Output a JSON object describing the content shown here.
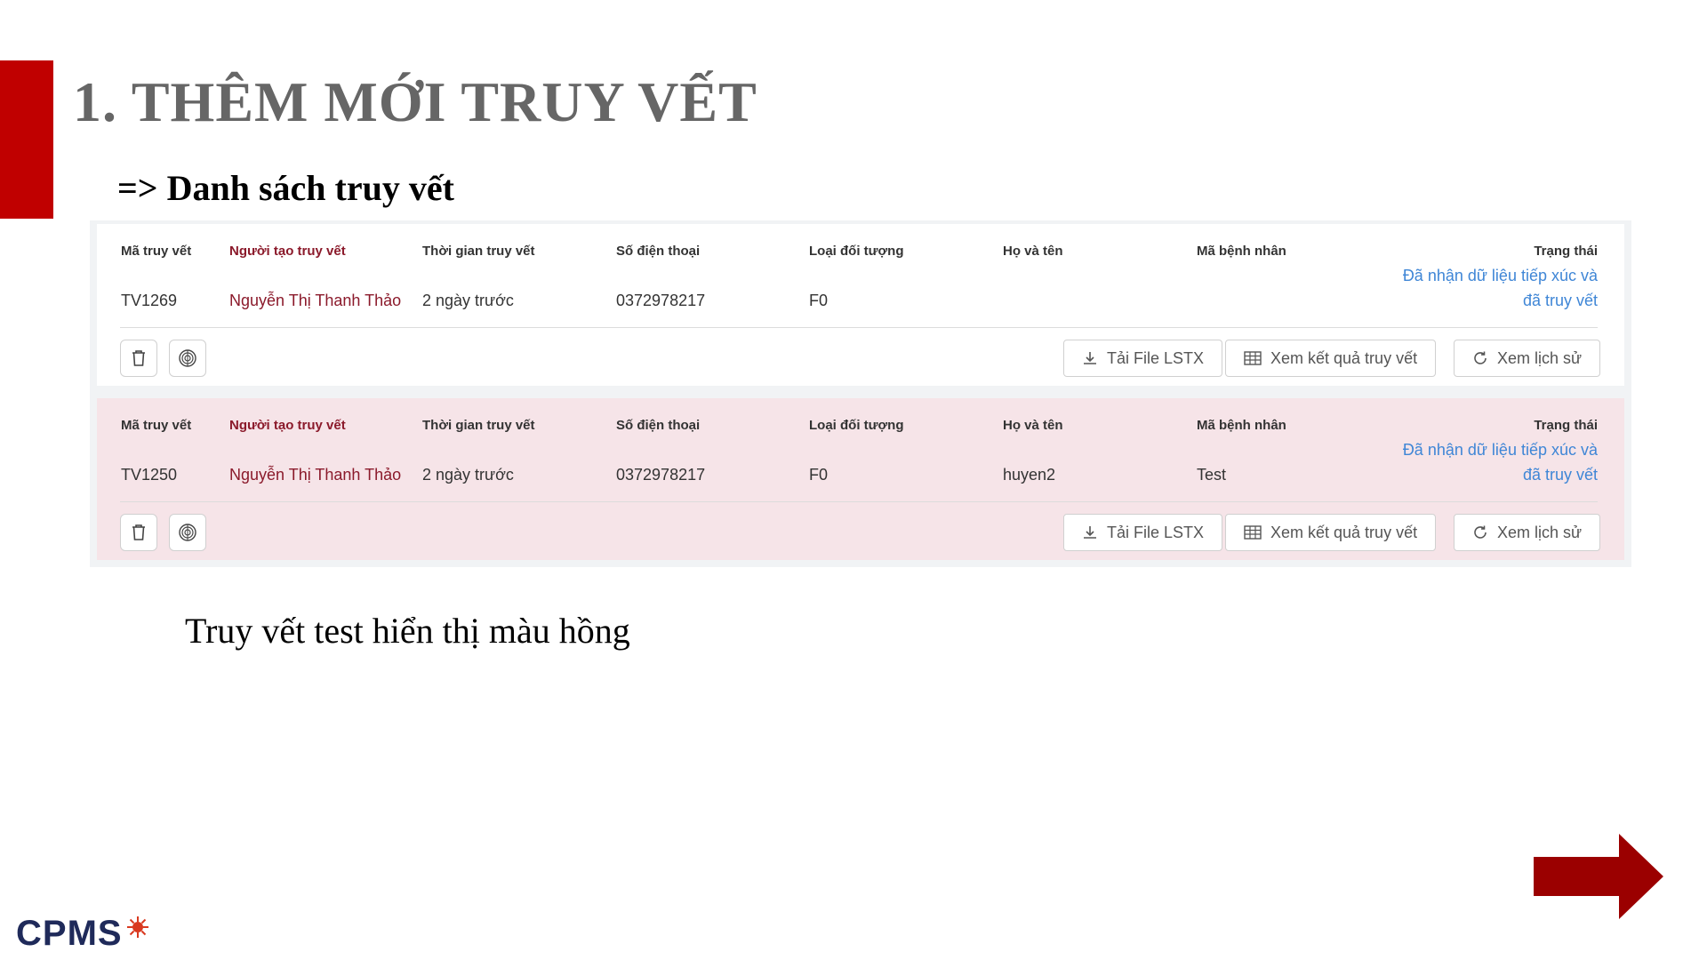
{
  "slide": {
    "title": "1. THÊM MỚI TRUY VẾT",
    "subtitle": "=> Danh sách truy vết",
    "caption": "Truy vết test hiển thị màu hồng",
    "logo": "CPMS",
    "accent_color": "#c00000",
    "arrow_color": "#9b0000"
  },
  "columns": {
    "code": "Mã truy vết",
    "creator": "Người tạo truy vết",
    "time": "Thời gian truy vết",
    "phone": "Số điện thoại",
    "type": "Loại đối tượng",
    "name": "Họ và tên",
    "patient": "Mã bệnh nhân",
    "status": "Trạng thái"
  },
  "records": [
    {
      "code": "TV1269",
      "creator": "Nguyễn Thị Thanh Thảo",
      "time": "2 ngày trước",
      "phone": "0372978217",
      "type": "F0",
      "name": "",
      "patient": "",
      "status_line1": "Đã nhận dữ liệu tiếp xúc và",
      "status_line2": "đã truy vết",
      "highlight": "white"
    },
    {
      "code": "TV1250",
      "creator": "Nguyễn Thị Thanh Thảo",
      "time": "2 ngày trước",
      "phone": "0372978217",
      "type": "F0",
      "name": "huyen2",
      "patient": "Test",
      "status_line1": "Đã nhận dữ liệu tiếp xúc và",
      "status_line2": "đã truy vết",
      "highlight": "pink"
    }
  ],
  "actions": {
    "download": "Tải File LSTX",
    "view_result": "Xem kết quả truy vết",
    "history": "Xem lịch sử"
  },
  "icons": {
    "delete": "trash-icon",
    "trace": "fingerprint-icon",
    "download": "download-icon",
    "table": "table-icon",
    "history": "history-icon",
    "next": "arrow-right-icon"
  }
}
